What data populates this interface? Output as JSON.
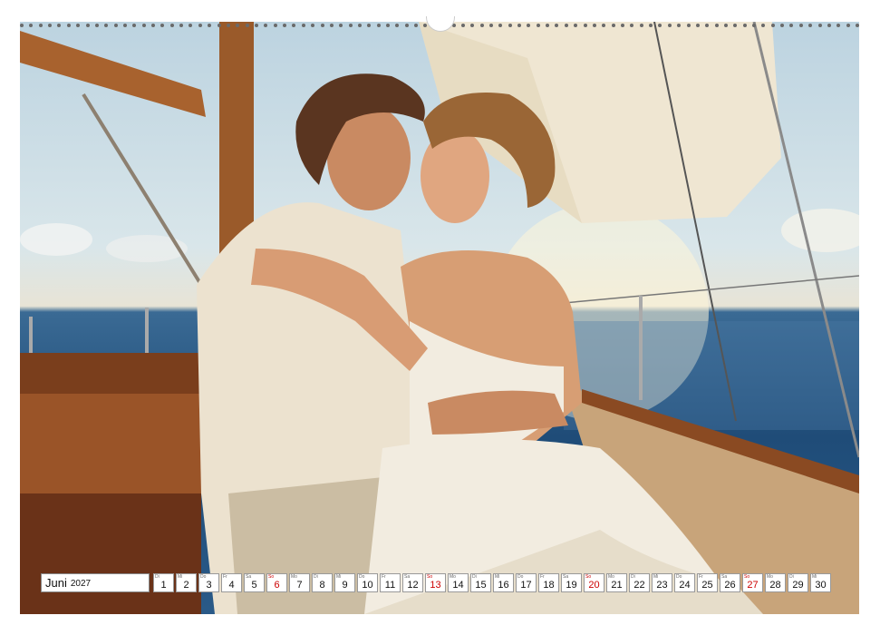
{
  "calendar": {
    "month": "Juni",
    "year": "2027",
    "days": [
      {
        "n": "1",
        "d": "Di",
        "we": false
      },
      {
        "n": "2",
        "d": "Mi",
        "we": false
      },
      {
        "n": "3",
        "d": "Do",
        "we": false
      },
      {
        "n": "4",
        "d": "Fr",
        "we": false
      },
      {
        "n": "5",
        "d": "Sa",
        "we": false
      },
      {
        "n": "6",
        "d": "So",
        "we": true
      },
      {
        "n": "7",
        "d": "Mo",
        "we": false
      },
      {
        "n": "8",
        "d": "Di",
        "we": false
      },
      {
        "n": "9",
        "d": "Mi",
        "we": false
      },
      {
        "n": "10",
        "d": "Do",
        "we": false
      },
      {
        "n": "11",
        "d": "Fr",
        "we": false
      },
      {
        "n": "12",
        "d": "Sa",
        "we": false
      },
      {
        "n": "13",
        "d": "So",
        "we": true
      },
      {
        "n": "14",
        "d": "Mo",
        "we": false
      },
      {
        "n": "15",
        "d": "Di",
        "we": false
      },
      {
        "n": "16",
        "d": "Mi",
        "we": false
      },
      {
        "n": "17",
        "d": "Do",
        "we": false
      },
      {
        "n": "18",
        "d": "Fr",
        "we": false
      },
      {
        "n": "19",
        "d": "Sa",
        "we": false
      },
      {
        "n": "20",
        "d": "So",
        "we": true
      },
      {
        "n": "21",
        "d": "Mo",
        "we": false
      },
      {
        "n": "22",
        "d": "Di",
        "we": false
      },
      {
        "n": "23",
        "d": "Mi",
        "we": false
      },
      {
        "n": "24",
        "d": "Do",
        "we": false
      },
      {
        "n": "25",
        "d": "Fr",
        "we": false
      },
      {
        "n": "26",
        "d": "Sa",
        "we": false
      },
      {
        "n": "27",
        "d": "So",
        "we": true
      },
      {
        "n": "28",
        "d": "Mo",
        "we": false
      },
      {
        "n": "29",
        "d": "Di",
        "we": false
      },
      {
        "n": "30",
        "d": "Mi",
        "we": false
      }
    ]
  },
  "colors": {
    "sunday": "#cc0000",
    "deck": "#c8a47a",
    "sail": "#efe6d2",
    "sea": "#1f4c78"
  }
}
